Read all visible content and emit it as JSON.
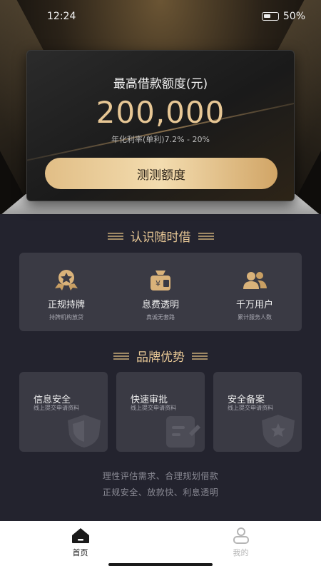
{
  "status_bar": {
    "time": "12:24",
    "battery": "50%"
  },
  "hero": {
    "title": "最高借款额度(元)",
    "amount": "200,000",
    "rate": "年化利率(单利)7.2% - 20%",
    "cta_label": "测测额度"
  },
  "about": {
    "title": "认识随时借",
    "items": [
      {
        "title": "正规持牌",
        "sub": "持牌机构放贷",
        "icon": "medal-icon"
      },
      {
        "title": "息费透明",
        "sub": "真诚无套路",
        "icon": "money-bag-icon"
      },
      {
        "title": "千万用户",
        "sub": "累计服务人数",
        "icon": "users-icon"
      }
    ]
  },
  "brand": {
    "title": "品牌优势",
    "items": [
      {
        "title": "信息安全",
        "sub": "线上提交申请资料",
        "icon": "shield-icon"
      },
      {
        "title": "快速审批",
        "sub": "线上提交申请资料",
        "icon": "document-edit-icon"
      },
      {
        "title": "安全备案",
        "sub": "线上提交申请资料",
        "icon": "star-shield-icon"
      }
    ]
  },
  "slogan": {
    "line1": "理性评估需求、合理规划借款",
    "line2": "正规安全、放款快、利息透明"
  },
  "tabbar": {
    "home": "首页",
    "mine": "我的"
  },
  "colors": {
    "gold": "#e7c795",
    "background": "#23232e",
    "card": "#3a3a44"
  }
}
